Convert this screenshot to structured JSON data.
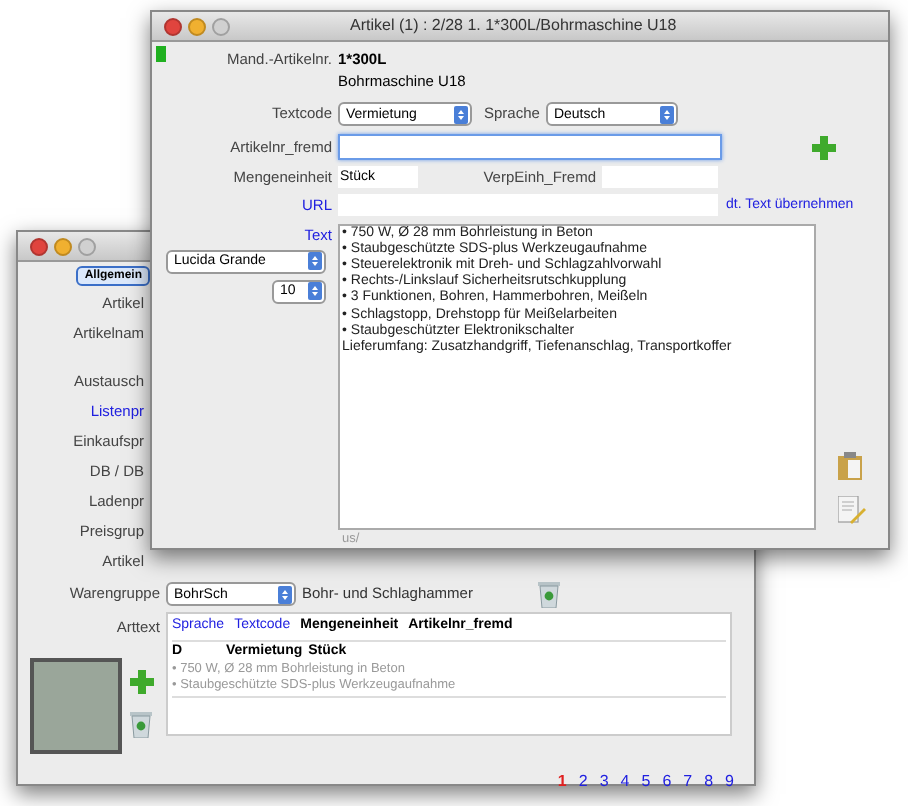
{
  "back_window": {
    "tab": {
      "label": "Allgemein",
      "selected": true
    },
    "labels": [
      {
        "text": "Artikel",
        "kind": "plain"
      },
      {
        "text": "Artikelnam",
        "kind": "plain"
      },
      {
        "text": "Austausch",
        "kind": "plain"
      },
      {
        "text": "Listenpr",
        "kind": "link"
      },
      {
        "text": "Einkaufspr",
        "kind": "plain"
      },
      {
        "text": "DB / DB",
        "kind": "plain"
      },
      {
        "text": "Ladenpr",
        "kind": "plain"
      },
      {
        "text": "Preisgrup",
        "kind": "plain"
      },
      {
        "text": "Artikel",
        "kind": "plain"
      }
    ],
    "warengruppe": {
      "label": "Warengruppe",
      "value": "BohrSch",
      "description": "Bohr- und Schlaghammer"
    },
    "text_table": {
      "label": "Arttext",
      "columns": [
        {
          "label": "Sprache",
          "kind": "link"
        },
        {
          "label": "Textcode",
          "kind": "link"
        },
        {
          "label": "Mengeneinheit",
          "kind": "plain"
        },
        {
          "label": "Artikelnr_fremd",
          "kind": "plain"
        }
      ],
      "rows": [
        {
          "sprache": "D",
          "textcode": "Vermietung",
          "mengeneinheit": "Stück",
          "lines": [
            "• 750 W, Ø 28 mm Bohrleistung in Beton",
            "• Staubgeschützte SDS-plus Werkzeugaufnahme"
          ]
        }
      ]
    },
    "pages": [
      {
        "label": "1",
        "selected": true
      },
      {
        "label": "2",
        "selected": false
      },
      {
        "label": "3",
        "selected": false
      },
      {
        "label": "4",
        "selected": false
      },
      {
        "label": "5",
        "selected": false
      },
      {
        "label": "6",
        "selected": false
      },
      {
        "label": "7",
        "selected": false
      },
      {
        "label": "8",
        "selected": false
      },
      {
        "label": "9",
        "selected": false
      }
    ]
  },
  "front_window": {
    "title": "Artikel (1) : 2/28 1. 1*300L/Bohrmaschine U18",
    "article_no": {
      "label": "Mand.-Artikelnr.",
      "value": "1*300L"
    },
    "article_name": "Bohrmaschine U18",
    "textcode": {
      "label": "Textcode",
      "value": "Vermietung"
    },
    "language": {
      "label": "Sprache",
      "value": "Deutsch"
    },
    "foreign_no": {
      "label": "Artikelnr_fremd"
    },
    "unit": {
      "label": "Mengeneinheit",
      "value": "Stück"
    },
    "foreign_pack": {
      "label": "VerpEinh_Fremd"
    },
    "url": {
      "label": "URL"
    },
    "copy_link": "dt. Text übernehmen",
    "text": {
      "label": "Text",
      "font": "Lucida Grande",
      "size": "10",
      "lines": [
        "• 750 W, Ø 28 mm Bohrleistung in Beton",
        "• Staubgeschützte SDS-plus Werkzeugaufnahme",
        "• Steuerelektronik mit Dreh- und Schlagzahlvorwahl",
        "• Rechts-/Linkslauf Sicherheitsrutschkupplung",
        "• 3 Funktionen, Bohren, Hammerbohren, Meißeln",
        "• Schlagstopp, Drehstopp für Meißelarbeiten",
        "• Staubgeschützter Elektronikschalter",
        "Lieferumfang: Zusatzhandgriff, Tiefenanschlag, Transportkoffer"
      ]
    },
    "footer": "us/"
  }
}
